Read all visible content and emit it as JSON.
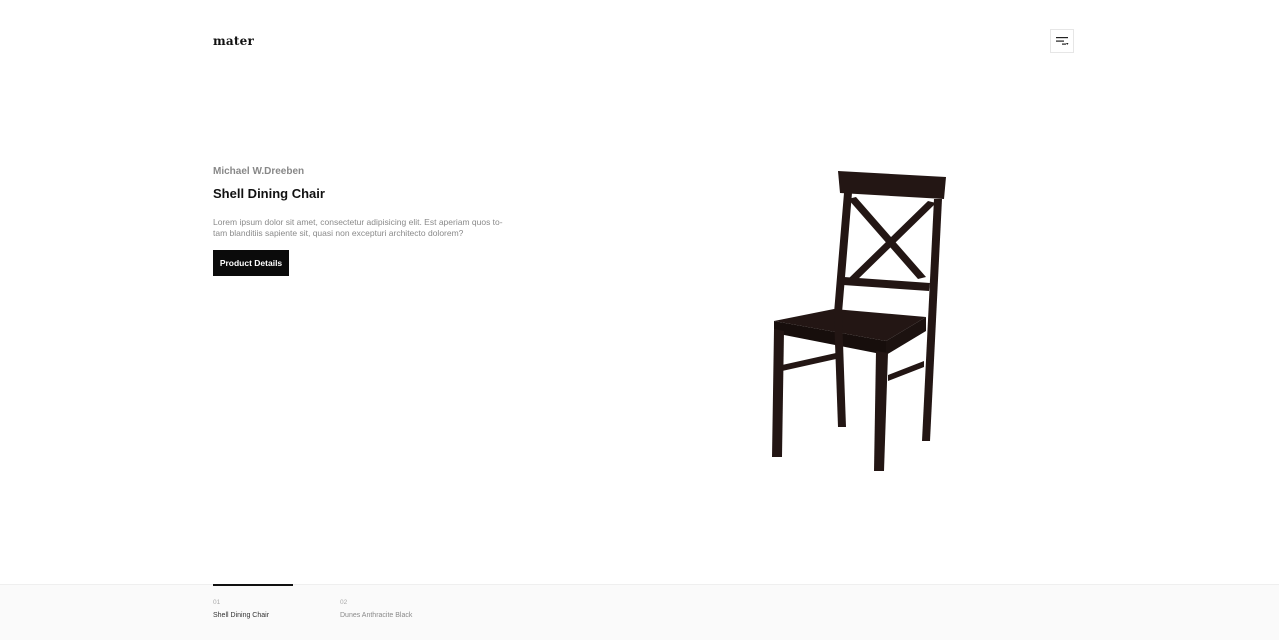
{
  "header": {
    "logo": "mater",
    "menu_icon": "filter-menu-icon"
  },
  "hero": {
    "author": "Michael W.Dreeben",
    "title": "Shell Dining Chair",
    "description": "Lorem ipsum dolor sit amet, consectetur adipisicing elit. Est aperiam quos to-tam blanditiis sapiente sit, quasi non excepturi architecto dolorem?",
    "button_label": "Product Details",
    "product_image": "dark-wooden-dining-chair"
  },
  "slides": [
    {
      "number": "01",
      "label": "Shell Dining Chair",
      "active": true
    },
    {
      "number": "02",
      "label": "Dunes Anthracite Black",
      "active": false
    }
  ],
  "colors": {
    "accent": "#0b0b0b",
    "background": "#ffffff",
    "footer_bg": "#fafafa",
    "chair": "#2a1a18"
  }
}
